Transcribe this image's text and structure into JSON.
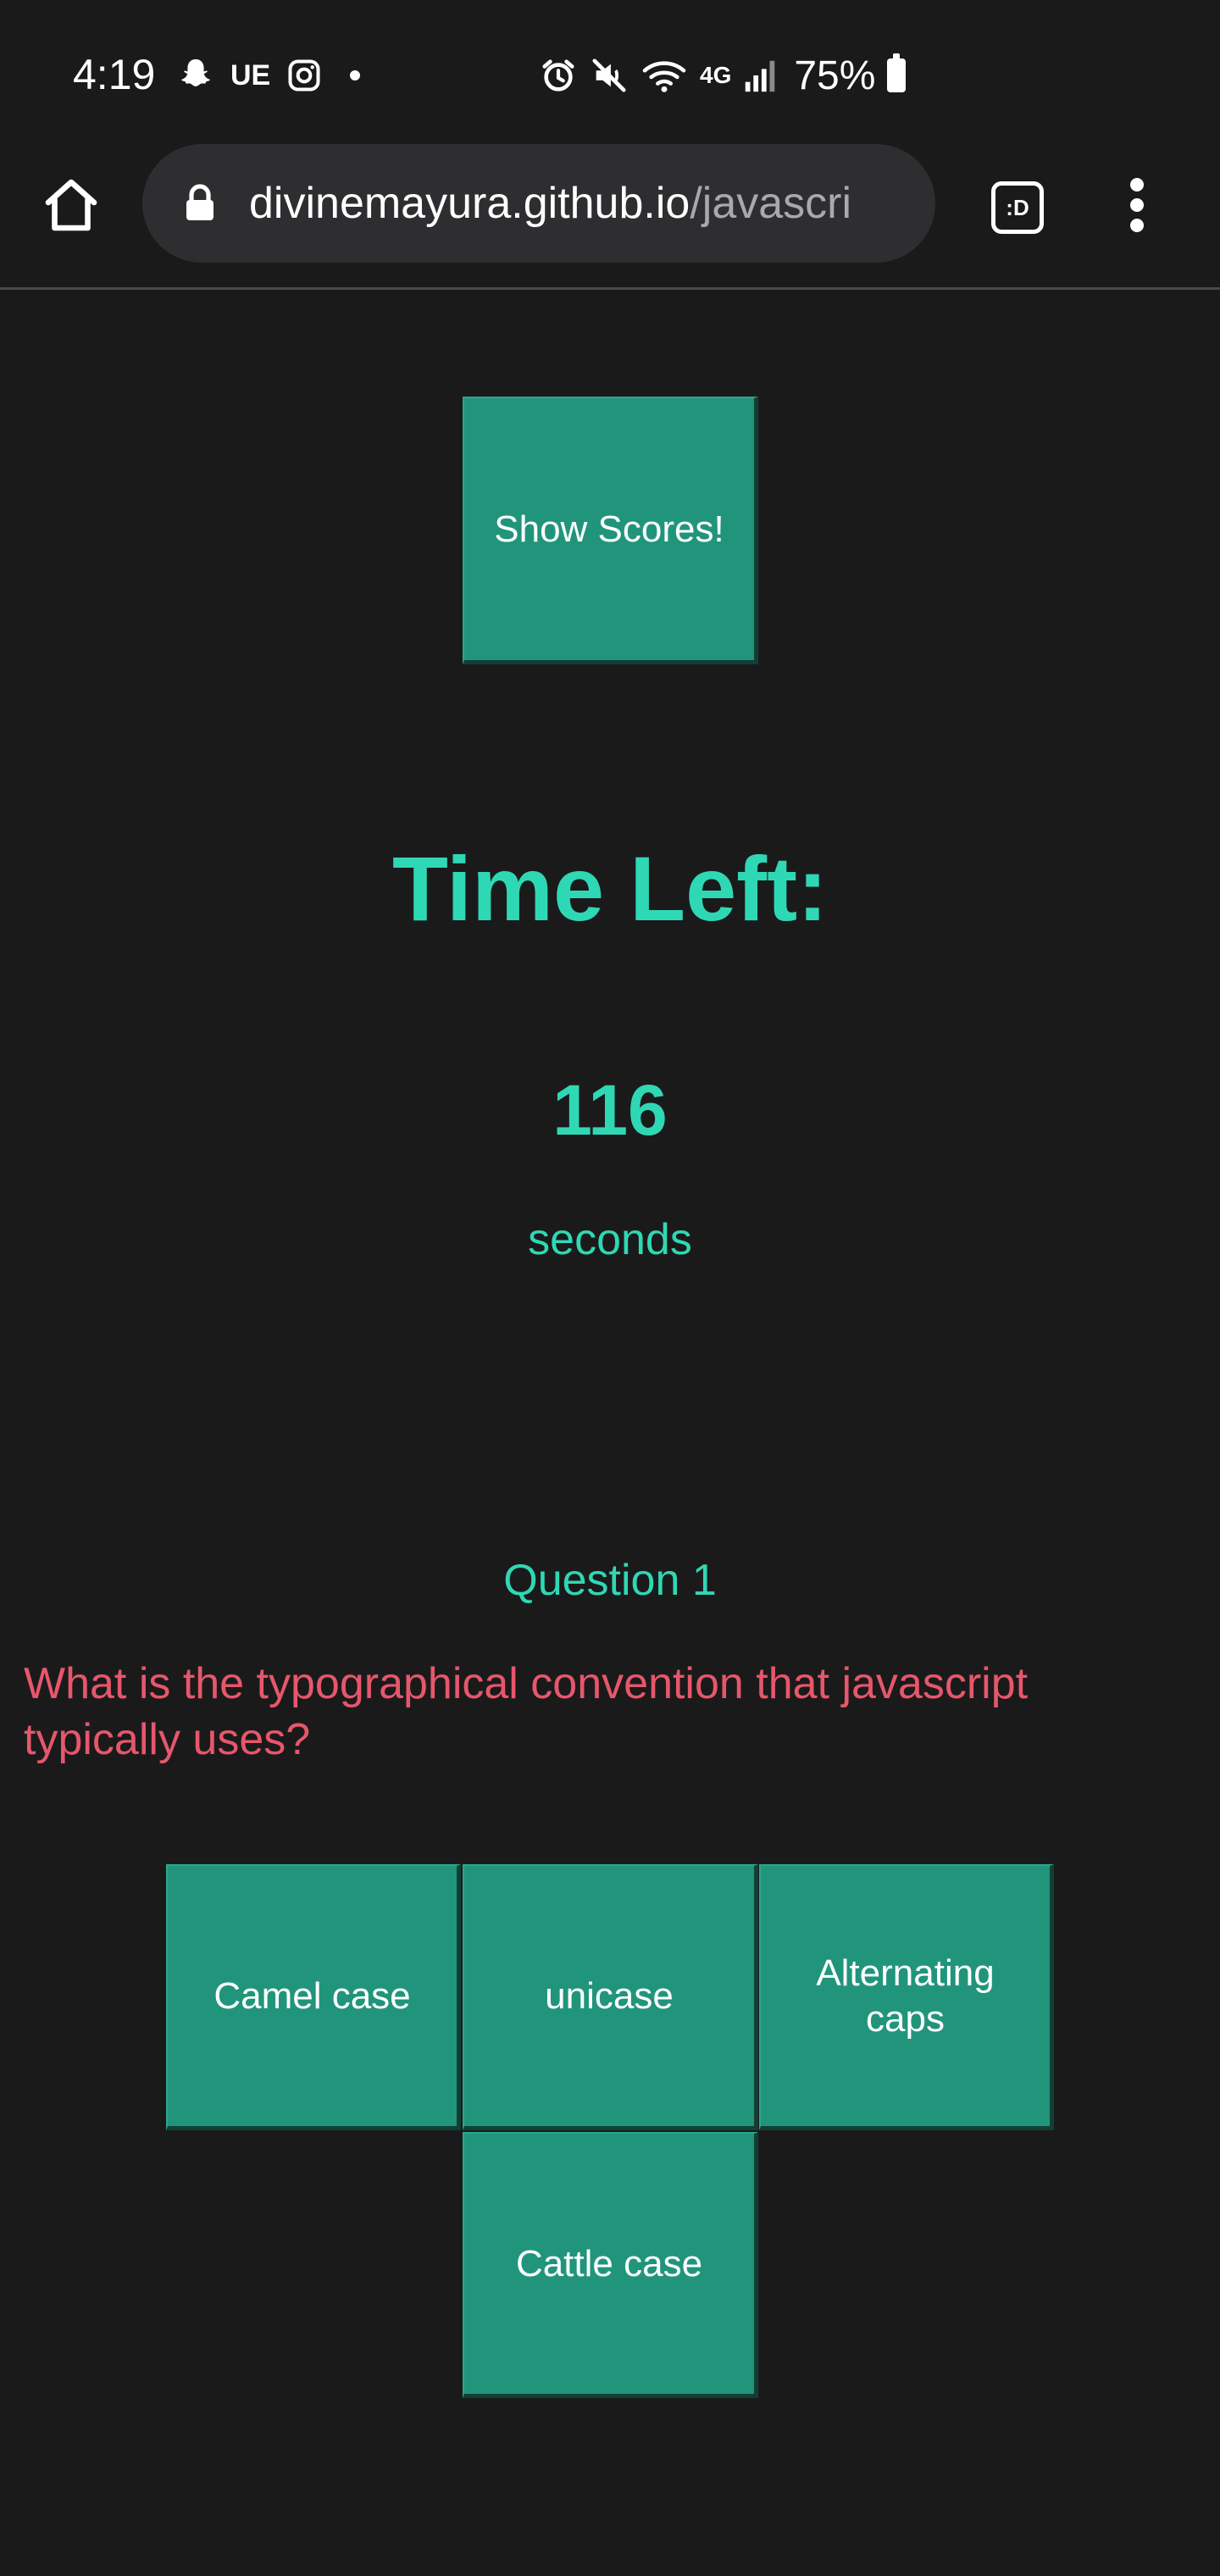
{
  "status_bar": {
    "time": "4:19",
    "left_icons": [
      "snapchat-icon",
      "ue-icon",
      "instagram-icon",
      "dot-icon"
    ],
    "ue_label": "UE",
    "right_icons": [
      "alarm-icon",
      "mute-icon",
      "wifi-icon",
      "4g-icon",
      "signal-icon",
      "battery-icon"
    ],
    "network_label": "4G",
    "battery_percent": "75%"
  },
  "browser": {
    "url_host": "divinemayura.github.io",
    "url_path": "/javascri",
    "tab_switcher_label": ":D"
  },
  "page": {
    "show_scores_label": "Show Scores!",
    "time_left_title": "Time Left:",
    "time_count": "116",
    "time_unit": "seconds",
    "question_number": "Question 1",
    "question_text": "What is the typographical convention that javascript typically uses?",
    "answers": [
      "Camel case",
      "unicase",
      "Alternating caps",
      "Cattle case"
    ]
  },
  "colors": {
    "background": "#1b1a1b",
    "accent_teal": "#2fd8b4",
    "button_teal": "#21957c",
    "question_red": "#e6576b"
  }
}
